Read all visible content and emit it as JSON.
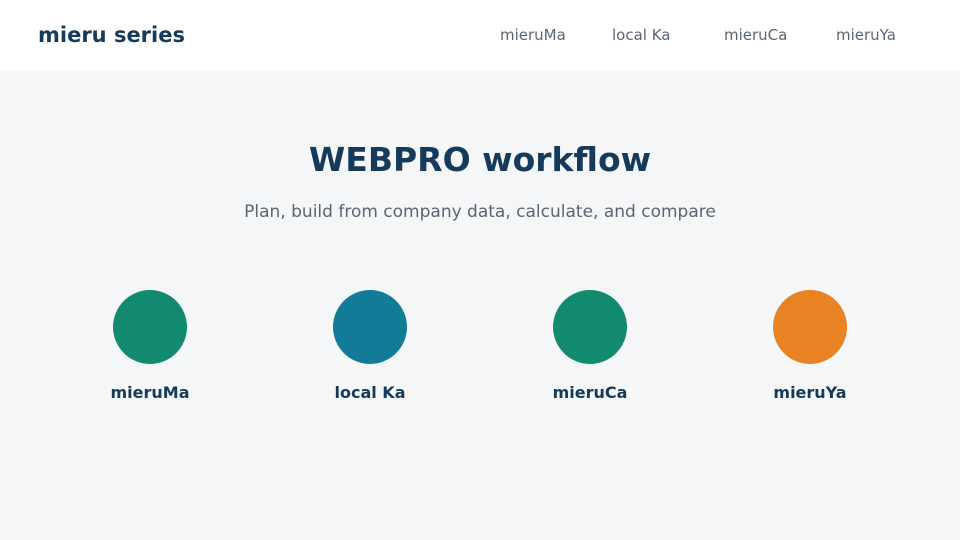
{
  "header": {
    "brand": "mieru series",
    "nav": [
      {
        "label": "mieruMa"
      },
      {
        "label": "local Ka"
      },
      {
        "label": "mieruCa"
      },
      {
        "label": "mieruYa"
      }
    ]
  },
  "main": {
    "title": "WEBPRO workflow",
    "subtitle": "Plan, build from company data, calculate, and compare",
    "steps": [
      {
        "label": "mieruMa",
        "color": "#118a70"
      },
      {
        "label": "local Ka",
        "color": "#127c98"
      },
      {
        "label": "mieruCa",
        "color": "#118a70"
      },
      {
        "label": "mieruYa",
        "color": "#e88222"
      }
    ]
  }
}
